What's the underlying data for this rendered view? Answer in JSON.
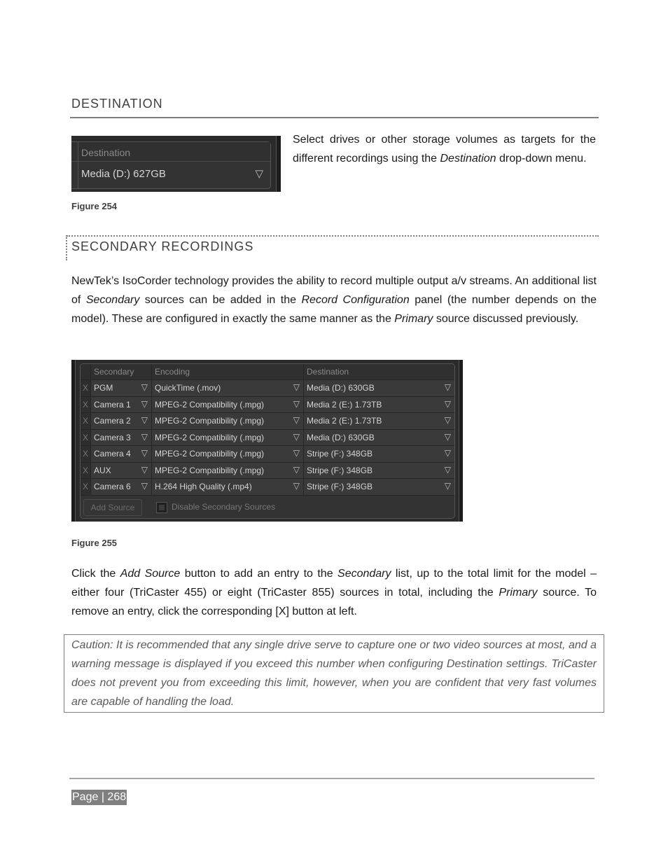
{
  "destination_section": {
    "heading": "DESTINATION",
    "figure": {
      "header_label": "Destination",
      "value": "Media (D:) 627GB",
      "dropdown_icon": "triangle-down-icon"
    },
    "description": [
      {
        "text": "Select drives or other storage volumes as targets for the different recordings using the ",
        "italic": false
      },
      {
        "text": "Destination",
        "italic": true
      },
      {
        "text": " drop-down menu.",
        "italic": false
      }
    ],
    "caption": "Figure 254"
  },
  "secondary_section": {
    "heading": "SECONDARY RECORDINGS",
    "paragraph": [
      {
        "text": "NewTek’s IsoCorder technology provides the ability to record multiple output a/v streams.  An additional list of ",
        "italic": false
      },
      {
        "text": "Secondary",
        "italic": true
      },
      {
        "text": " sources can be added in the ",
        "italic": false
      },
      {
        "text": "Record Configuration",
        "italic": true
      },
      {
        "text": " panel (the number depends on the model). These are configured in exactly the same manner as the ",
        "italic": false
      },
      {
        "text": "Primary",
        "italic": true
      },
      {
        "text": " source discussed previously.",
        "italic": false
      }
    ],
    "figure": {
      "columns": [
        "Secondary",
        "Encoding",
        "Destination"
      ],
      "rows": [
        {
          "remove": "X",
          "source": "PGM",
          "encoding": "QuickTime (.mov)",
          "destination": "Media (D:) 630GB"
        },
        {
          "remove": "X",
          "source": "Camera 1",
          "encoding": "MPEG-2 Compatibility (.mpg)",
          "destination": "Media 2 (E:) 1.73TB"
        },
        {
          "remove": "X",
          "source": "Camera 2",
          "encoding": "MPEG-2 Compatibility (.mpg)",
          "destination": "Media 2 (E:) 1.73TB"
        },
        {
          "remove": "X",
          "source": "Camera 3",
          "encoding": "MPEG-2 Compatibility (.mpg)",
          "destination": "Media (D:) 630GB"
        },
        {
          "remove": "X",
          "source": "Camera 4",
          "encoding": "MPEG-2 Compatibility (.mpg)",
          "destination": "Stripe (F:) 348GB"
        },
        {
          "remove": "X",
          "source": "AUX",
          "encoding": "MPEG-2 Compatibility (.mpg)",
          "destination": "Stripe (F:) 348GB"
        },
        {
          "remove": "X",
          "source": "Camera 6",
          "encoding": "H.264 High Quality (.mp4)",
          "destination": "Stripe (F:) 348GB"
        }
      ],
      "add_source_label": "Add Source",
      "disable_label": "Disable Secondary Sources",
      "dropdown_glyph": "▽"
    },
    "caption": "Figure 255",
    "paragraph2": [
      {
        "text": "Click the ",
        "italic": false
      },
      {
        "text": "Add Source",
        "italic": true
      },
      {
        "text": " button to add an entry to the ",
        "italic": false
      },
      {
        "text": "Secondary",
        "italic": true
      },
      {
        "text": " list, up to the total limit for the model – either four (TriCaster 455) or eight (TriCaster 855) sources in total, including the ",
        "italic": false
      },
      {
        "text": "Primary",
        "italic": true
      },
      {
        "text": " source.  To remove an entry, click the corresponding [X] button at left.",
        "italic": false
      }
    ],
    "caution": "Caution: It is recommended that any single drive serve to capture one or two video sources at most, and a warning message is displayed if you exceed this number when configuring Destination settings.  TriCaster does not prevent you from exceeding this limit, however, when you are confident that very fast volumes are capable of handling the load."
  },
  "footer": {
    "page_label": "Page | 268"
  }
}
